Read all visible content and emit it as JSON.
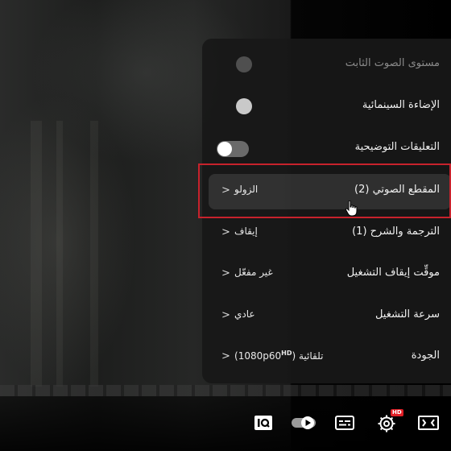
{
  "settings_menu": {
    "items": [
      {
        "label": "مستوى الصوت الثابت",
        "control": "dot",
        "state": "off",
        "disabled": true
      },
      {
        "label": "الإضاءة السينمائية",
        "control": "dot",
        "state": "on"
      },
      {
        "label": "التعليقات التوضيحية",
        "control": "toggle",
        "state": "off"
      },
      {
        "label": "المقطع الصوتي (2)",
        "value": "الزولو",
        "highlighted": true
      },
      {
        "label": "الترجمة والشرح (1)",
        "value": "إيقاف"
      },
      {
        "label": "موقِّت إيقاف التشغيل",
        "value": "غير مفعّل"
      },
      {
        "label": "سرعة التشغيل",
        "value": "عادي"
      },
      {
        "label": "الجودة",
        "value": "تلقائية",
        "quality_detail": "(1080p60",
        "quality_badge": "HD",
        "quality_close": ")"
      }
    ]
  },
  "player_controls": {
    "hd_badge": "HD",
    "icons": [
      "quality-iq-icon",
      "autoplay-toggle-icon",
      "subtitles-icon",
      "settings-gear-icon",
      "theater-mode-icon"
    ]
  },
  "colors": {
    "highlight_border": "#c7222c",
    "hd_badge": "#e01f26",
    "panel_bg": "#181818"
  }
}
